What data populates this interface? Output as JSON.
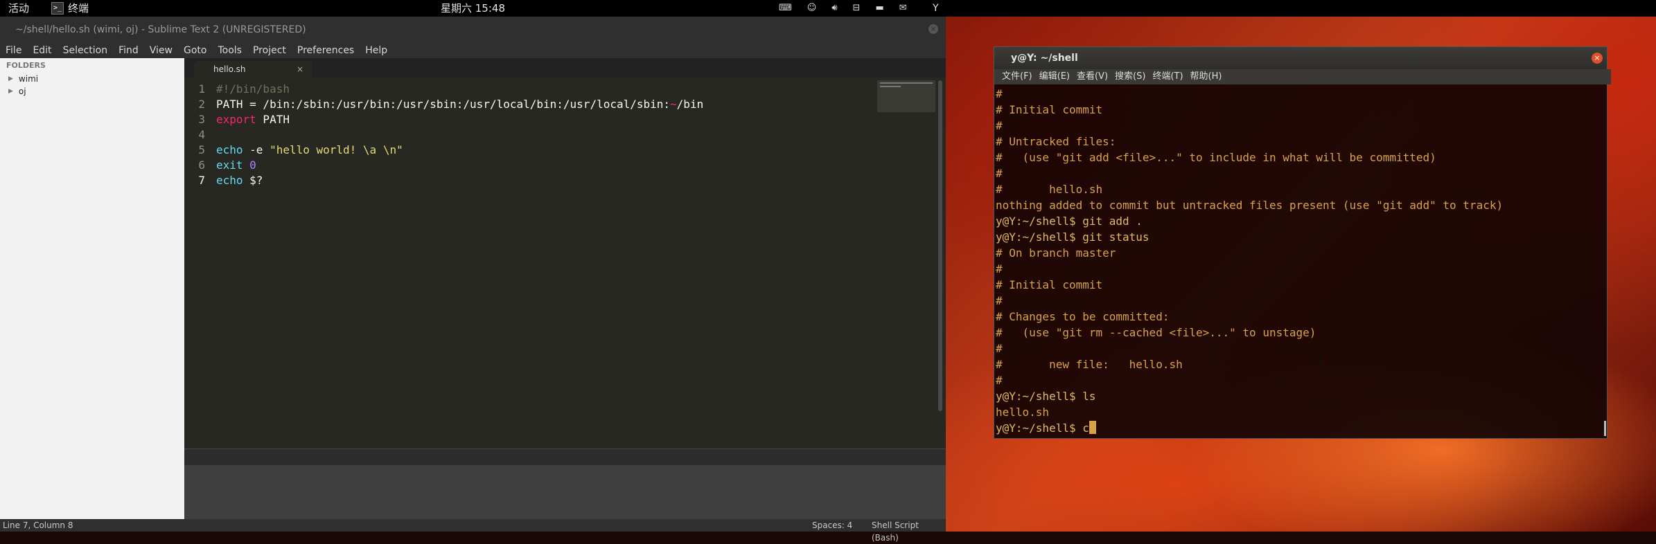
{
  "topbar": {
    "activities": "活动",
    "app_icon_glyph": ">_",
    "app_name": "终端",
    "clock": "星期六 15:48",
    "user": "Y",
    "tray_icons": [
      "keyboard-icon",
      "accessibility-icon",
      "volume-icon",
      "network-icon",
      "battery-icon",
      "user-icon"
    ]
  },
  "sublime": {
    "title": "~/shell/hello.sh (wimi, oj) - Sublime Text 2 (UNREGISTERED)",
    "menu": [
      "File",
      "Edit",
      "Selection",
      "Find",
      "View",
      "Goto",
      "Tools",
      "Project",
      "Preferences",
      "Help"
    ],
    "sidebar": {
      "header": "FOLDERS",
      "folders": [
        "wimi",
        "oj"
      ]
    },
    "tab": {
      "name": "hello.sh",
      "close": "×"
    },
    "lines": [
      {
        "num": "1",
        "parts": [
          {
            "t": "#!/bin/bash",
            "c": "cm"
          }
        ]
      },
      {
        "num": "2",
        "parts": [
          {
            "t": "PATH = /bin:/sbin:/usr/bin:/usr/sbin:/usr/local/bin:/usr/local/sbin:",
            "c": ""
          },
          {
            "t": "~",
            "c": "kw"
          },
          {
            "t": "/bin",
            "c": ""
          }
        ]
      },
      {
        "num": "3",
        "parts": [
          {
            "t": "export",
            "c": "kw"
          },
          {
            "t": " PATH",
            "c": ""
          }
        ]
      },
      {
        "num": "4",
        "parts": [
          {
            "t": "",
            "c": ""
          }
        ]
      },
      {
        "num": "5",
        "parts": [
          {
            "t": "echo",
            "c": "fn"
          },
          {
            "t": " -e ",
            "c": ""
          },
          {
            "t": "\"hello world! \\a \\n\"",
            "c": "st"
          }
        ]
      },
      {
        "num": "6",
        "parts": [
          {
            "t": "exit",
            "c": "fn"
          },
          {
            "t": " ",
            "c": ""
          },
          {
            "t": "0",
            "c": "nu"
          }
        ]
      },
      {
        "num": "7",
        "parts": [
          {
            "t": "echo",
            "c": "fn"
          },
          {
            "t": " $?",
            "c": ""
          }
        ]
      }
    ],
    "status": {
      "position": "Line 7, Column 8",
      "spaces": "Spaces: 4",
      "syntax": "Shell Script (Bash)"
    }
  },
  "terminal": {
    "title": "y@Y: ~/shell",
    "menu": [
      "文件(F)",
      "编辑(E)",
      "查看(V)",
      "搜索(S)",
      "终端(T)",
      "帮助(H)"
    ],
    "lines": [
      "#",
      "# Initial commit",
      "#",
      "# Untracked files:",
      "#   (use \"git add <file>...\" to include in what will be committed)",
      "#",
      "#       hello.sh",
      "nothing added to commit but untracked files present (use \"git add\" to track)",
      "y@Y:~/shell$ git add .",
      "y@Y:~/shell$ git status",
      "# On branch master",
      "#",
      "# Initial commit",
      "#",
      "# Changes to be committed:",
      "#   (use \"git rm --cached <file>...\" to unstage)",
      "#",
      "#       new file:   hello.sh",
      "#",
      "y@Y:~/shell$ ls",
      "hello.sh"
    ],
    "current_prompt": "y@Y:~/shell$ c"
  }
}
